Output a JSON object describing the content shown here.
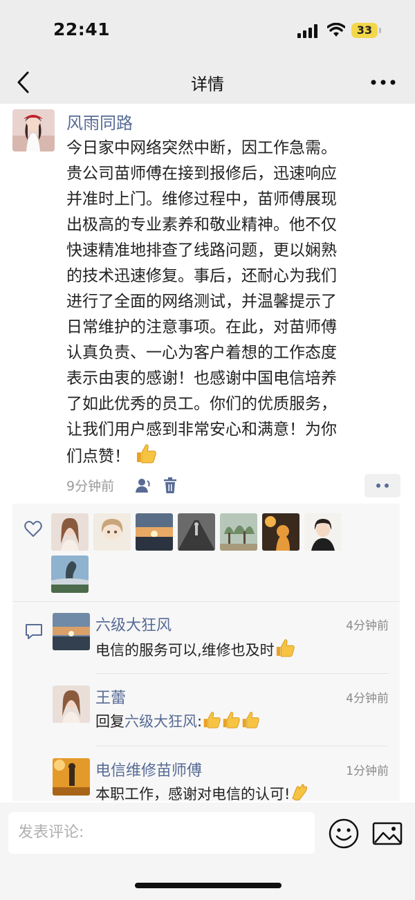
{
  "status_bar": {
    "time": "22:41",
    "battery": "33"
  },
  "nav": {
    "title": "详情"
  },
  "post": {
    "author": "风雨同路",
    "text": "今日家中网络突然中断，因工作急需。\n贵公司苗师傅在接到报修后，迅速响应\n并准时上门。维修过程中，苗师傅展现\n出极高的专业素养和敬业精神。他不仅\n快速精准地排查了线路问题，更以娴熟\n的技术迅速修复。事后，还耐心为我们\n进行了全面的网络测试，并温馨提示了\n日常维护的注意事项。在此，对苗师傅\n认真负责、一心为客户着想的工作态度\n表示由衷的感谢！也感谢中国电信培养\n了如此优秀的员工。你们的优质服务，\n让我们用户感到非常安心和满意！为你\n们点赞！",
    "time_ago": "9分钟前"
  },
  "likes_count": 8,
  "comments": [
    {
      "name": "六级大狂风",
      "time": "4分钟前",
      "text": "电信的服务可以,维修也及时"
    },
    {
      "name": "王蕾",
      "time": "4分钟前",
      "reply_prefix": "回复",
      "reply_to": "六级大狂风",
      "text": ":"
    },
    {
      "name": "电信维修苗师傅",
      "time": "1分钟前",
      "text": "本职工作，感谢对电信的认可!"
    }
  ],
  "composer": {
    "placeholder": "发表评论:"
  },
  "colors": {
    "link": "#576b95",
    "header_bg": "#ededed",
    "panel_bg": "#f7f7f7",
    "battery": "#f3d74a"
  },
  "icons": [
    "back-icon",
    "more-icon",
    "person-icon",
    "trash-icon",
    "heart-icon",
    "comment-icon",
    "emoji-icon",
    "image-icon",
    "thumbs-up-icon",
    "clapping-hands-icon"
  ]
}
